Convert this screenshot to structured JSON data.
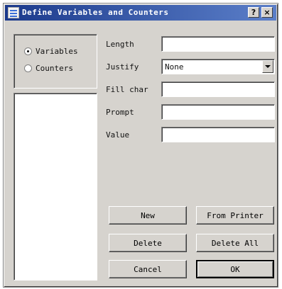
{
  "window": {
    "title": "Define Variables and Counters",
    "help_button": "?",
    "close_button": "×"
  },
  "mode": {
    "options": [
      {
        "label": "Variables",
        "selected": true
      },
      {
        "label": "Counters",
        "selected": false
      }
    ]
  },
  "form": {
    "length_label": "Length",
    "length_value": "",
    "justify_label": "Justify",
    "justify_value": "None",
    "fill_char_label": "Fill char",
    "fill_char_value": "",
    "prompt_label": "Prompt",
    "prompt_value": "",
    "value_label": "Value",
    "value_value": ""
  },
  "buttons": {
    "new": "New",
    "from_printer": "From Printer",
    "delete": "Delete",
    "delete_all": "Delete All",
    "cancel": "Cancel",
    "ok": "OK"
  }
}
